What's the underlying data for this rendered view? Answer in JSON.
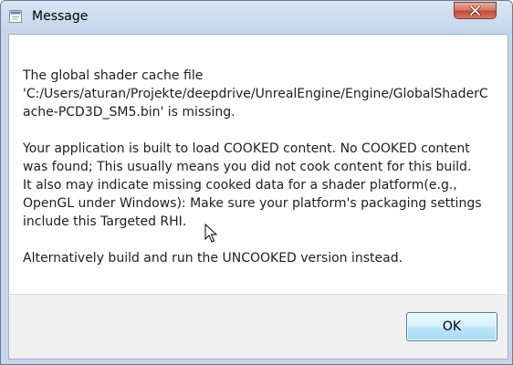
{
  "window": {
    "title": "Message",
    "close_icon": "close-icon"
  },
  "message": {
    "paragraphs": [
      "The global shader cache file\n'C:/Users/aturan/Projekte/deepdrive/UnrealEngine/Engine/GlobalShaderC\nache-PCD3D_SM5.bin' is missing.",
      "Your application is built to load COOKED content. No COOKED content\nwas found; This usually means you did not cook content for this build.\nIt also may indicate missing cooked data for a shader platform(e.g.,\nOpenGL under Windows): Make sure your platform's packaging settings\ninclude this Targeted RHI.",
      "Alternatively build and run the UNCOOKED version instead."
    ]
  },
  "buttons": {
    "ok_label": "OK"
  },
  "colors": {
    "titlebar": "#c6d6ea",
    "close_button": "#c14a33",
    "ok_button_border": "#3c7fb1"
  }
}
